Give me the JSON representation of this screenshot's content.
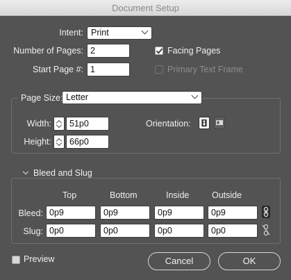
{
  "window": {
    "title": "Document Setup"
  },
  "intent": {
    "label": "Intent:",
    "value": "Print"
  },
  "pages": {
    "number_label": "Number of Pages:",
    "number_value": "2",
    "start_label": "Start Page #:",
    "start_value": "1"
  },
  "options": {
    "facing_pages": {
      "label": "Facing Pages",
      "checked": true
    },
    "primary_text_frame": {
      "label": "Primary Text Frame",
      "checked": false,
      "enabled": false
    }
  },
  "page_size": {
    "label": "Page Size:",
    "value": "Letter",
    "width_label": "Width:",
    "width_value": "51p0",
    "height_label": "Height:",
    "height_value": "66p0",
    "orientation_label": "Orientation:",
    "orientation": "portrait"
  },
  "bleed_slug": {
    "title": "Bleed and Slug",
    "columns": [
      "Top",
      "Bottom",
      "Inside",
      "Outside"
    ],
    "bleed_label": "Bleed:",
    "bleed": [
      "0p9",
      "0p9",
      "0p9",
      "0p9"
    ],
    "slug_label": "Slug:",
    "slug": [
      "0p0",
      "0p0",
      "0p0",
      "0p0"
    ]
  },
  "footer": {
    "preview_label": "Preview",
    "cancel_label": "Cancel",
    "ok_label": "OK"
  },
  "colors": {
    "panel": "#535353",
    "field": "#ffffff",
    "text": "#efefef"
  },
  "icons": [
    "chevron-down-icon",
    "checkmark-icon",
    "stepper-icon",
    "portrait-icon",
    "landscape-icon",
    "chain-linked-icon",
    "chain-broken-icon"
  ]
}
